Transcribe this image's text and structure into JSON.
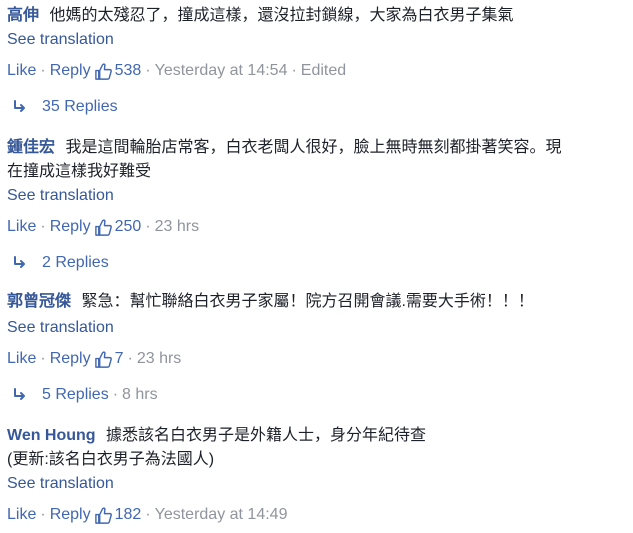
{
  "comments": [
    {
      "author": "高伸",
      "text": "他媽的太殘忍了，撞成這樣，還沒拉封鎖線，大家為白衣男子集氣",
      "translate": "See translation",
      "like": "Like",
      "reply": "Reply",
      "likes": "538",
      "time": "Yesterday at 14:54",
      "edited": "Edited",
      "replies": "35 Replies"
    },
    {
      "author": "鍾佳宏",
      "text_line1": "我是這間輪胎店常客，白衣老闆人很好，臉上無時無刻都掛著笑容。現",
      "text_line2": "在撞成這樣我好難受",
      "translate": "See translation",
      "like": "Like",
      "reply": "Reply",
      "likes": "250",
      "time": "23 hrs",
      "replies": "2 Replies"
    },
    {
      "author": "郭曾冠傑",
      "text": "緊急：幫忙聯絡白衣男子家屬！院方召開會議.需要大手術！！！",
      "translate": "See translation",
      "like": "Like",
      "reply": "Reply",
      "likes": "7",
      "time": "23 hrs",
      "replies": "5 Replies",
      "replies_time": "8 hrs"
    },
    {
      "author": "Wen Houng",
      "text_line1": "據悉該名白衣男子是外籍人士，身分年紀待查",
      "text_line2": "(更新:該名白衣男子為法國人)",
      "translate": "See translation",
      "like": "Like",
      "reply": "Reply",
      "likes": "182",
      "time": "Yesterday at 14:49"
    }
  ],
  "colors": {
    "author": "#365899",
    "link": "#4267b2",
    "meta": "#90949c",
    "text": "#1d2129"
  },
  "icons": {
    "like": "thumbs-up-outline-icon",
    "reply_arrow": "reply-arrow-icon"
  }
}
